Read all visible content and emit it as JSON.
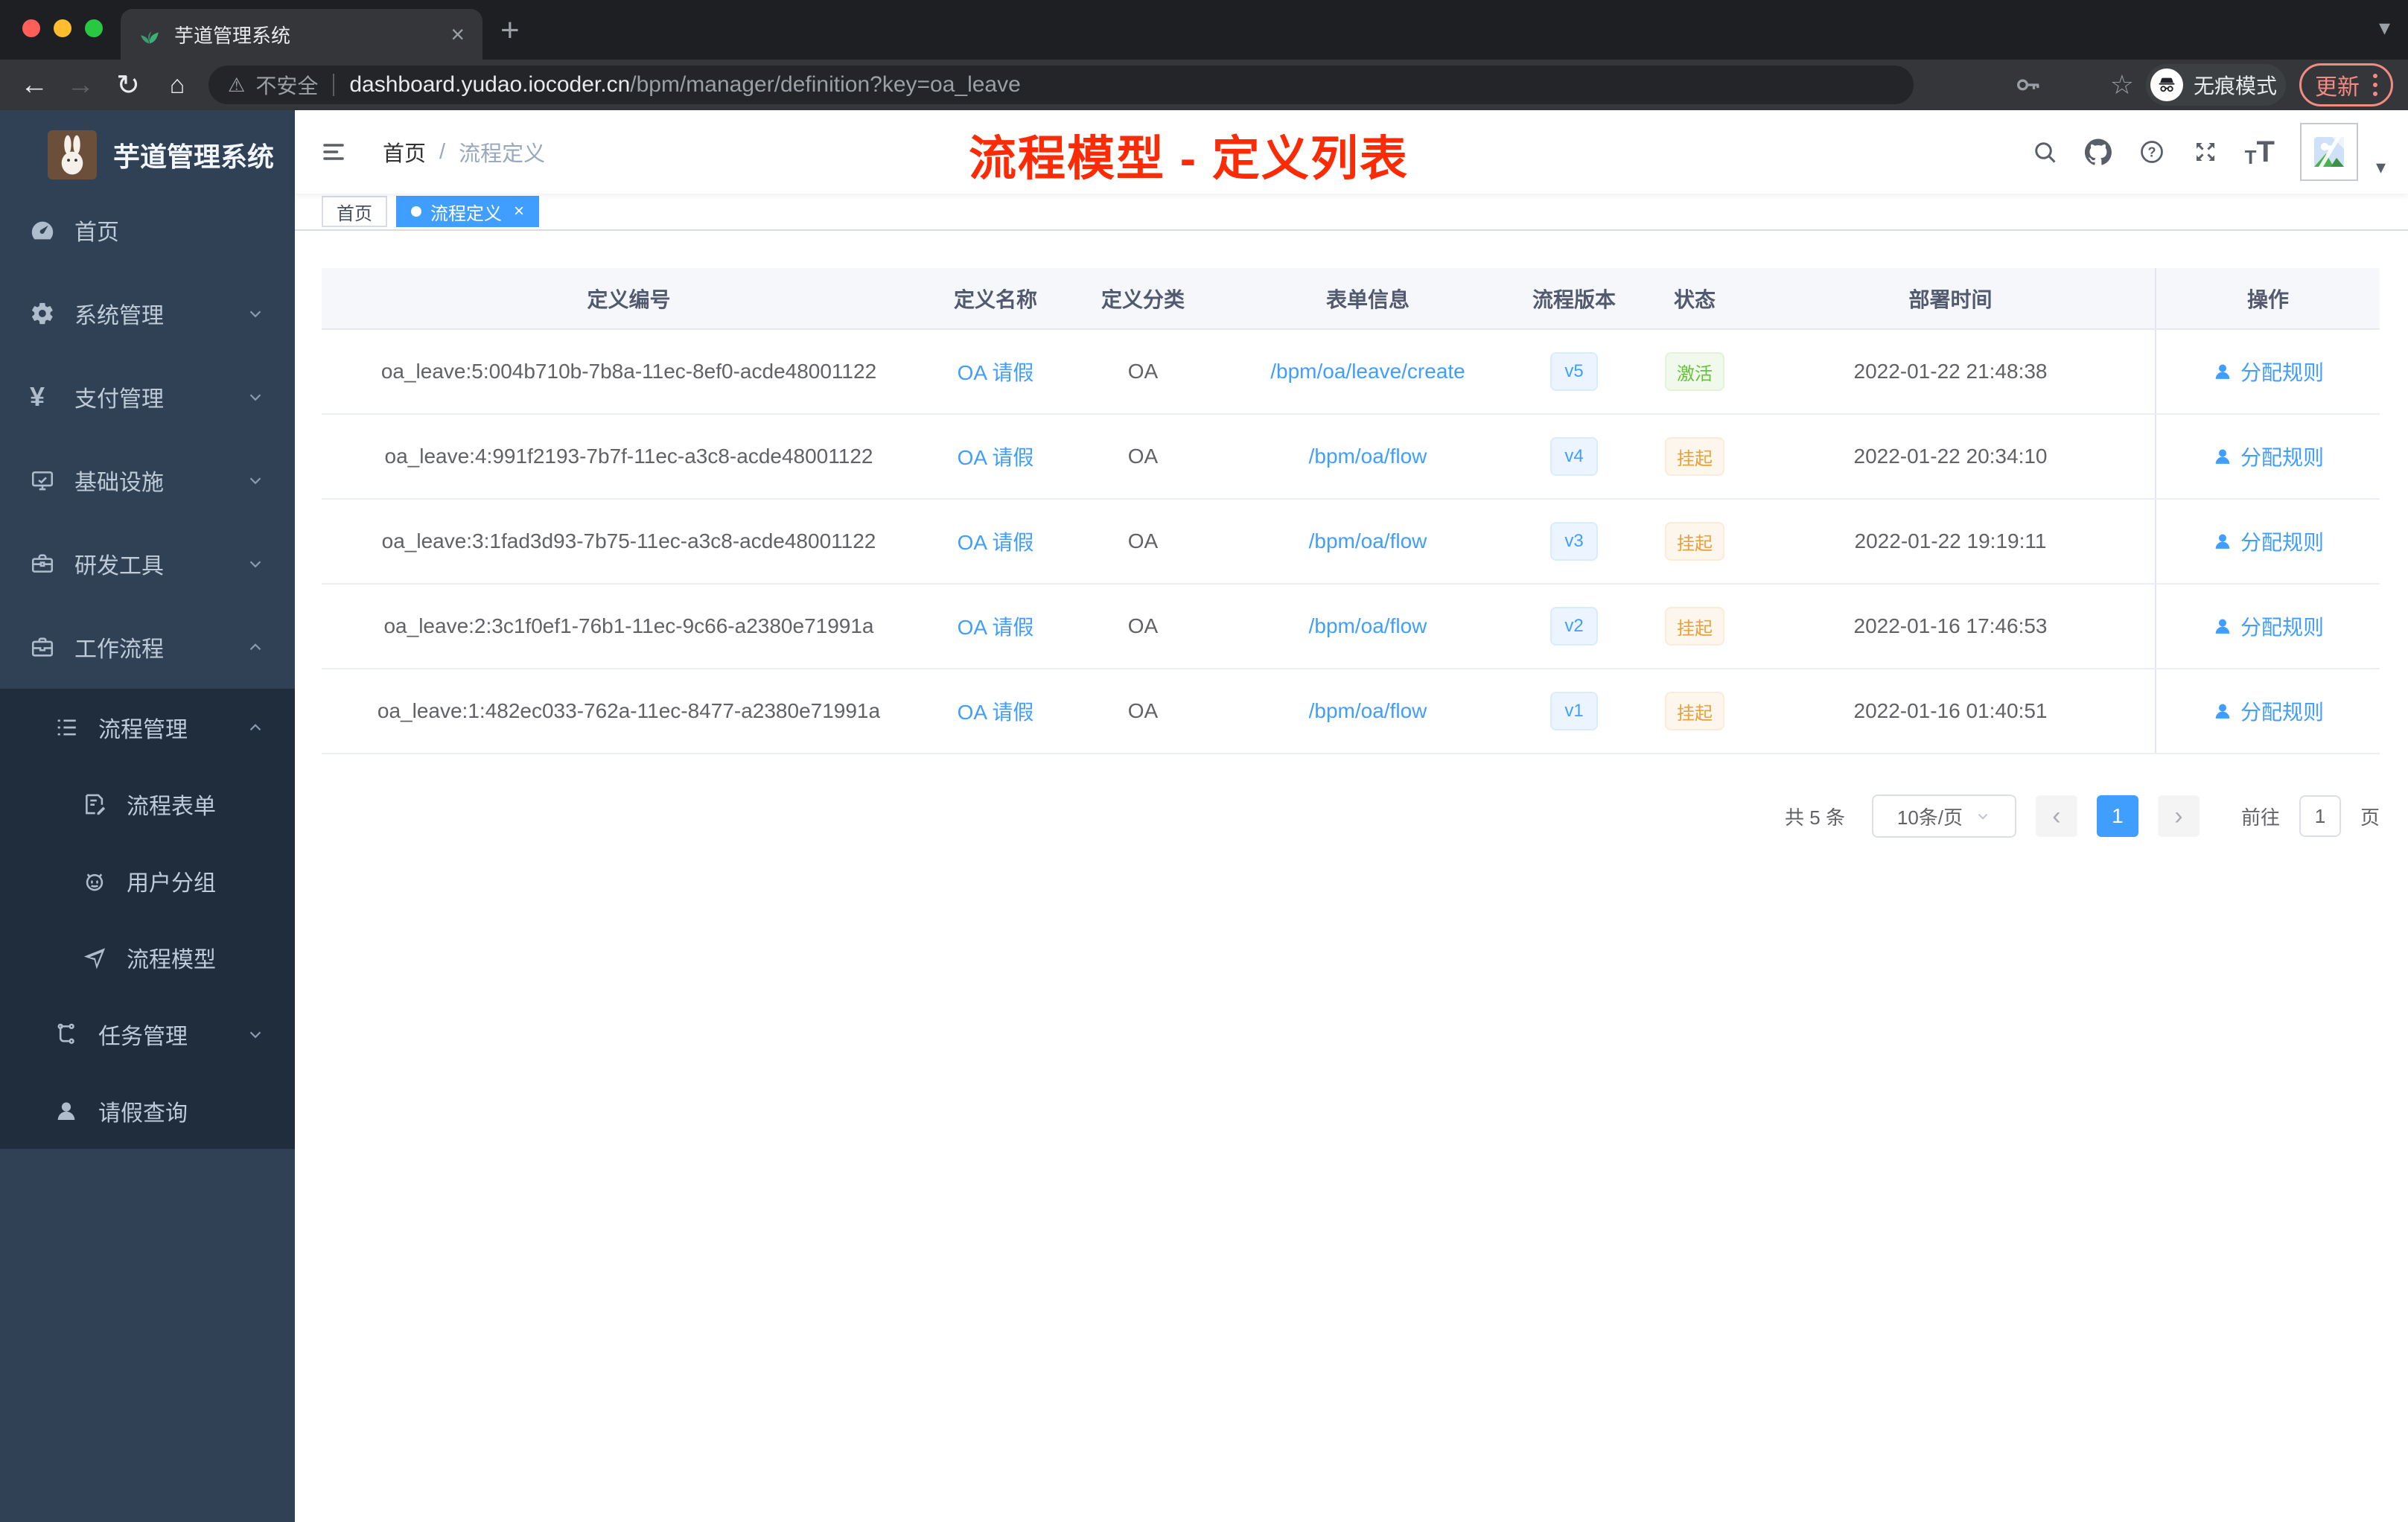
{
  "browser": {
    "tab": {
      "title": "芋道管理系统"
    },
    "address": {
      "warning_label": "不安全",
      "domain": "dashboard.yudao.iocoder.cn",
      "path": "/bpm/manager/definition?key=oa_leave"
    },
    "incognito_label": "无痕模式",
    "update_label": "更新"
  },
  "icons": {
    "back": "←",
    "forward": "→",
    "reload": "↻",
    "home": "⌂",
    "warning": "⚠",
    "star": "☆",
    "close": "×",
    "new_tab": "+",
    "menu_caret": "▾",
    "prev": "‹",
    "next": "›",
    "yen": "¥",
    "font_size_small": "T",
    "font_size_large": "T"
  },
  "sidebar": {
    "logo_title": "芋道管理系统",
    "items": [
      {
        "label": "首页",
        "icon": "gauge-icon"
      },
      {
        "label": "系统管理",
        "icon": "gear-icon",
        "chevron": "down"
      },
      {
        "label": "支付管理",
        "icon": "yen-icon",
        "chevron": "down"
      },
      {
        "label": "基础设施",
        "icon": "monitor-icon",
        "chevron": "down"
      },
      {
        "label": "研发工具",
        "icon": "toolbox-icon",
        "chevron": "down"
      },
      {
        "label": "工作流程",
        "icon": "briefcase-icon",
        "chevron": "up"
      }
    ],
    "subitems": [
      {
        "label": "流程管理",
        "icon": "list-icon",
        "chevron": "up",
        "level": 1
      },
      {
        "label": "流程表单",
        "icon": "form-icon",
        "level": 2
      },
      {
        "label": "用户分组",
        "icon": "robot-icon",
        "level": 2
      },
      {
        "label": "流程模型",
        "icon": "plane-icon",
        "level": 2
      },
      {
        "label": "任务管理",
        "icon": "tree-icon",
        "chevron": "down",
        "level": 1
      },
      {
        "label": "请假查询",
        "icon": "user-icon",
        "level": 1
      }
    ]
  },
  "header": {
    "breadcrumb": [
      "首页",
      "流程定义"
    ],
    "separator": "/",
    "annotation": "流程模型 - 定义列表"
  },
  "tags": [
    {
      "label": "首页",
      "active": false
    },
    {
      "label": "流程定义",
      "active": true
    }
  ],
  "table": {
    "columns": [
      "定义编号",
      "定义名称",
      "定义分类",
      "表单信息",
      "流程版本",
      "状态",
      "部署时间",
      "操作"
    ],
    "rows": [
      {
        "id": "oa_leave:5:004b710b-7b8a-11ec-8ef0-acde48001122",
        "name": "OA 请假",
        "category": "OA",
        "form": "/bpm/oa/leave/create",
        "version": "v5",
        "status": "激活",
        "status_type": "success",
        "deploy_time": "2022-01-22 21:48:38",
        "action": "分配规则"
      },
      {
        "id": "oa_leave:4:991f2193-7b7f-11ec-a3c8-acde48001122",
        "name": "OA 请假",
        "category": "OA",
        "form": "/bpm/oa/flow",
        "version": "v4",
        "status": "挂起",
        "status_type": "warning",
        "deploy_time": "2022-01-22 20:34:10",
        "action": "分配规则"
      },
      {
        "id": "oa_leave:3:1fad3d93-7b75-11ec-a3c8-acde48001122",
        "name": "OA 请假",
        "category": "OA",
        "form": "/bpm/oa/flow",
        "version": "v3",
        "status": "挂起",
        "status_type": "warning",
        "deploy_time": "2022-01-22 19:19:11",
        "action": "分配规则"
      },
      {
        "id": "oa_leave:2:3c1f0ef1-76b1-11ec-9c66-a2380e71991a",
        "name": "OA 请假",
        "category": "OA",
        "form": "/bpm/oa/flow",
        "version": "v2",
        "status": "挂起",
        "status_type": "warning",
        "deploy_time": "2022-01-16 17:46:53",
        "action": "分配规则"
      },
      {
        "id": "oa_leave:1:482ec033-762a-11ec-8477-a2380e71991a",
        "name": "OA 请假",
        "category": "OA",
        "form": "/bpm/oa/flow",
        "version": "v1",
        "status": "挂起",
        "status_type": "warning",
        "deploy_time": "2022-01-16 01:40:51",
        "action": "分配规则"
      }
    ]
  },
  "pagination": {
    "total": "共 5 条",
    "page_size": "10条/页",
    "current": "1",
    "goto_label": "前往",
    "goto_value": "1",
    "unit": "页"
  },
  "colors": {
    "accent": "#409eff",
    "sidebar": "#304156",
    "sidebar_submenu": "#1f2d3d",
    "success": "#67c23a",
    "warning": "#e6a23c",
    "annotation_red": "#fb2b05",
    "update_red": "#f28b82"
  }
}
